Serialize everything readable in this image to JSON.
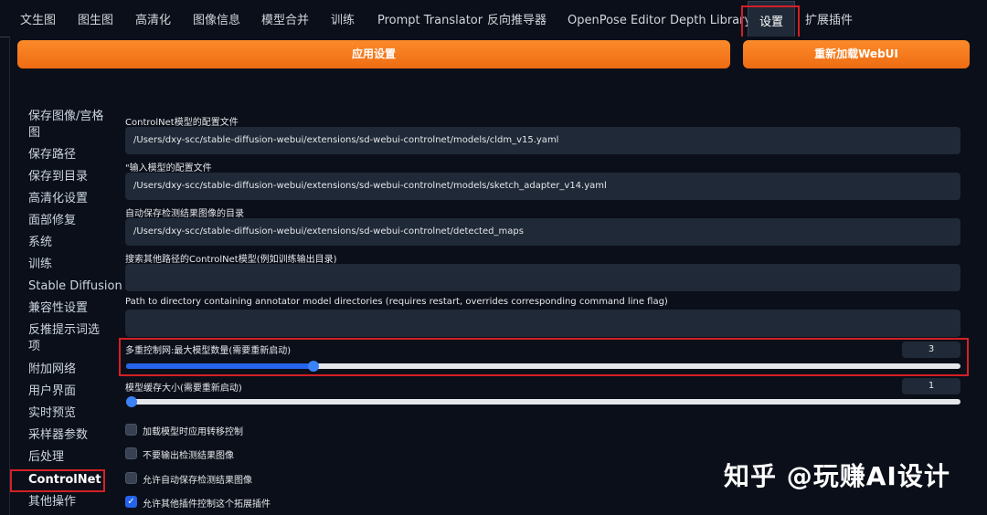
{
  "tabs": [
    "文生图",
    "图生图",
    "高清化",
    "图像信息",
    "模型合并",
    "训练",
    "Prompt Translator",
    "反向推导器",
    "OpenPose Editor",
    "Depth Library",
    "设置",
    "扩展插件"
  ],
  "buttons": {
    "apply": "应用设置",
    "reload": "重新加载WebUI"
  },
  "sidebar": [
    "保存图像/宫格",
    "图",
    "保存路径",
    "保存到目录",
    "高清化设置",
    "面部修复",
    "系统",
    "训练",
    "Stable Diffusion",
    "兼容性设置",
    "反推提示词选",
    "项",
    "附加网络",
    "用户界面",
    "实时预览",
    "采样器参数",
    "后处理",
    "ControlNet",
    "其他操作"
  ],
  "fields": [
    {
      "label": "ControlNet模型的配置文件",
      "value": "/Users/dxy-scc/stable-diffusion-webui/extensions/sd-webui-controlnet/models/cldm_v15.yaml"
    },
    {
      "label": "\"输入模型的配置文件",
      "value": "/Users/dxy-scc/stable-diffusion-webui/extensions/sd-webui-controlnet/models/sketch_adapter_v14.yaml"
    },
    {
      "label": "自动保存检测结果图像的目录",
      "value": "/Users/dxy-scc/stable-diffusion-webui/extensions/sd-webui-controlnet/detected_maps"
    },
    {
      "label": "搜索其他路径的ControlNet模型(例如训练输出目录)",
      "value": ""
    },
    {
      "label": "Path to directory containing annotator model directories (requires restart, overrides corresponding command line flag)",
      "value": ""
    }
  ],
  "sliders": [
    {
      "label": "多重控制网:最大模型数量(需要重新启动)",
      "value": "3",
      "fraction": 0.225
    },
    {
      "label": "模型缓存大小(需要重新启动)",
      "value": "1",
      "fraction": 0.0
    }
  ],
  "checkboxes": [
    {
      "label": "加载模型时应用转移控制",
      "checked": false
    },
    {
      "label": "不要输出检测结果图像",
      "checked": false
    },
    {
      "label": "允许自动保存检测结果图像",
      "checked": false
    },
    {
      "label": "允许其他插件控制这个拓展插件",
      "checked": true
    }
  ],
  "checkmark": "✓",
  "watermark": "知乎 @玩赚AI设计",
  "colors": {
    "accent": "#f97316",
    "highlight": "#d32026",
    "slider": "#2563eb"
  }
}
